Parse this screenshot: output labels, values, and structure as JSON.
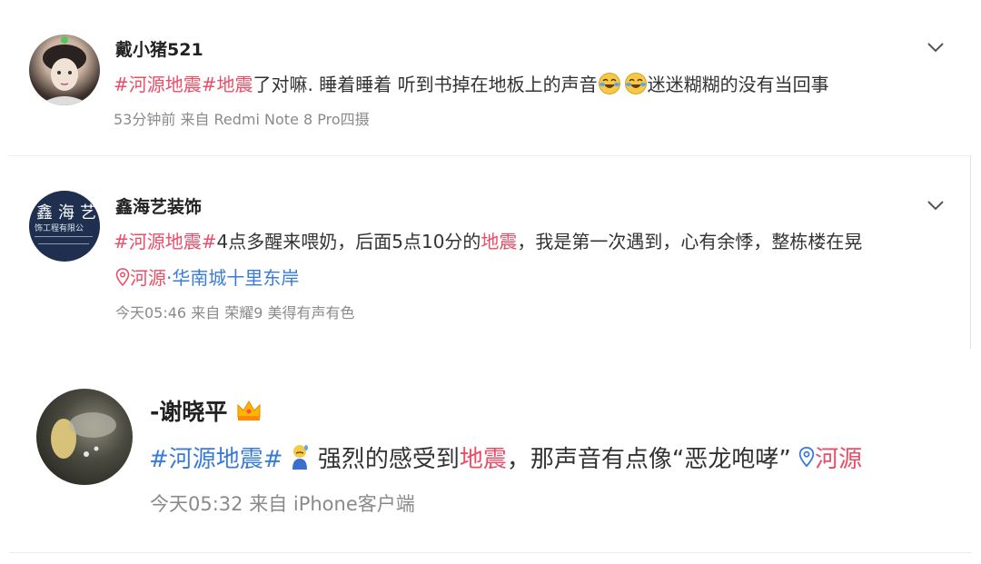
{
  "posts": [
    {
      "username": "戴小猪521",
      "topic1": "#河源地震#",
      "keyword1": "地震",
      "text1": "了对嘛. 睡着睡着 听到书掉在地板上的声音",
      "text2": "迷迷糊糊的没有当回事",
      "meta": "53分钟前  来自 Redmi Note 8 Pro四摄",
      "emoji_icon": "crying-laughing-emoji-icon"
    },
    {
      "username": "鑫海艺装饰",
      "avatar_text_1": "鑫海艺",
      "avatar_text_2": "饰工程有限公",
      "topic1": "#河源地震#",
      "text1": "4点多醒来喂奶，后面5点10分的",
      "keyword1": "地震",
      "text2": "，我是第一次遇到，心有余悸，整栋楼在晃",
      "location_city": "河源",
      "location_place": "·华南城十里东岸",
      "meta": "今天05:46  来自 荣耀9 美得有声有色"
    },
    {
      "username": "-谢晓平",
      "topic1": "#河源地震#",
      "text1": " 强烈的感受到",
      "keyword1": "地震",
      "text2": "，那声音有点像“恶龙咆哮” ",
      "location_city": "河源",
      "meta": "今天05:32  来自 iPhone客户端",
      "badge_icon": "crown-icon",
      "emoji_icon": "sweating-person-emoji-icon"
    }
  ],
  "colors": {
    "accent": "#eb4d67",
    "meta": "#8a8a8a",
    "divider": "#ececec"
  }
}
